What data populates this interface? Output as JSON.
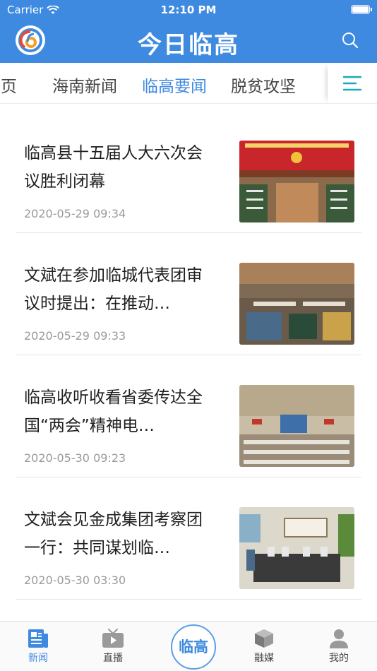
{
  "status_bar": {
    "carrier": "Carrier",
    "time": "12:10 PM"
  },
  "header": {
    "app_title": "今日临高",
    "logo_icon": "linggao-logo-icon",
    "search_icon": "search-icon"
  },
  "tabs": [
    {
      "label": "首页",
      "active": false
    },
    {
      "label": "海南新闻",
      "active": false
    },
    {
      "label": "临高要闻",
      "active": true
    },
    {
      "label": "脱贫攻坚",
      "active": false
    }
  ],
  "menu_icon": "menu-icon",
  "news": [
    {
      "title": "临高县十五届人大六次会议胜利闭幕",
      "date": "2020-05-29 09:34"
    },
    {
      "title": "文斌在参加临城代表团审议时提出：在推动…",
      "date": "2020-05-29 09:33"
    },
    {
      "title": "临高收听收看省委传达全国“两会”精神电…",
      "date": "2020-05-30 09:23"
    },
    {
      "title": "文斌会见金成集团考察团一行：共同谋划临…",
      "date": "2020-05-30 03:30"
    }
  ],
  "bottom_nav": {
    "news": "新闻",
    "live": "直播",
    "center": "临高",
    "media": "融媒",
    "mine": "我的"
  },
  "colors": {
    "brand": "#3e8ae0",
    "text": "#1f1f1f",
    "muted": "#9a9a9a"
  }
}
